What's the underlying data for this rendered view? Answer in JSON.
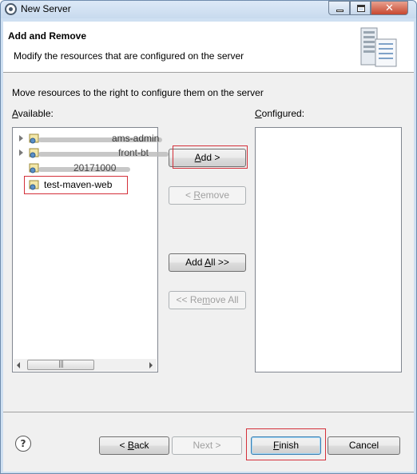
{
  "window": {
    "title": "New Server"
  },
  "header": {
    "title": "Add and Remove",
    "description": "Modify the resources that are configured on the server"
  },
  "body": {
    "instruction": "Move resources to the right to configure them on the server",
    "available_label_prefix": "",
    "available_label_accel": "A",
    "available_label_rest": "vailable:",
    "configured_label_accel": "C",
    "configured_label_rest": "onfigured:"
  },
  "available_list": {
    "items": [
      {
        "label": "ams-admin"
      },
      {
        "label": "front-bt"
      },
      {
        "label": "20171000"
      },
      {
        "label": "test-maven-web",
        "selected": true
      }
    ]
  },
  "buttons": {
    "add": {
      "accel": "A",
      "rest": "dd >"
    },
    "remove": {
      "pre": "< ",
      "accel": "R",
      "rest": "emove"
    },
    "add_all": {
      "pre": "Add ",
      "accel": "A",
      "rest": "ll >>"
    },
    "remove_all": {
      "pre": "<< Re",
      "accel": "m",
      "rest": "ove All"
    }
  },
  "footer": {
    "back": {
      "pre": "< ",
      "accel": "B",
      "rest": "ack"
    },
    "next": {
      "label": "Next >"
    },
    "finish": {
      "accel": "F",
      "rest": "inish"
    },
    "cancel": {
      "label": "Cancel"
    }
  },
  "colors": {
    "highlight_frame": "#d4303a",
    "window_frame": "#cfe0f2"
  },
  "icons": [
    "app-icon",
    "server-graphic",
    "project-icon",
    "help-icon"
  ]
}
